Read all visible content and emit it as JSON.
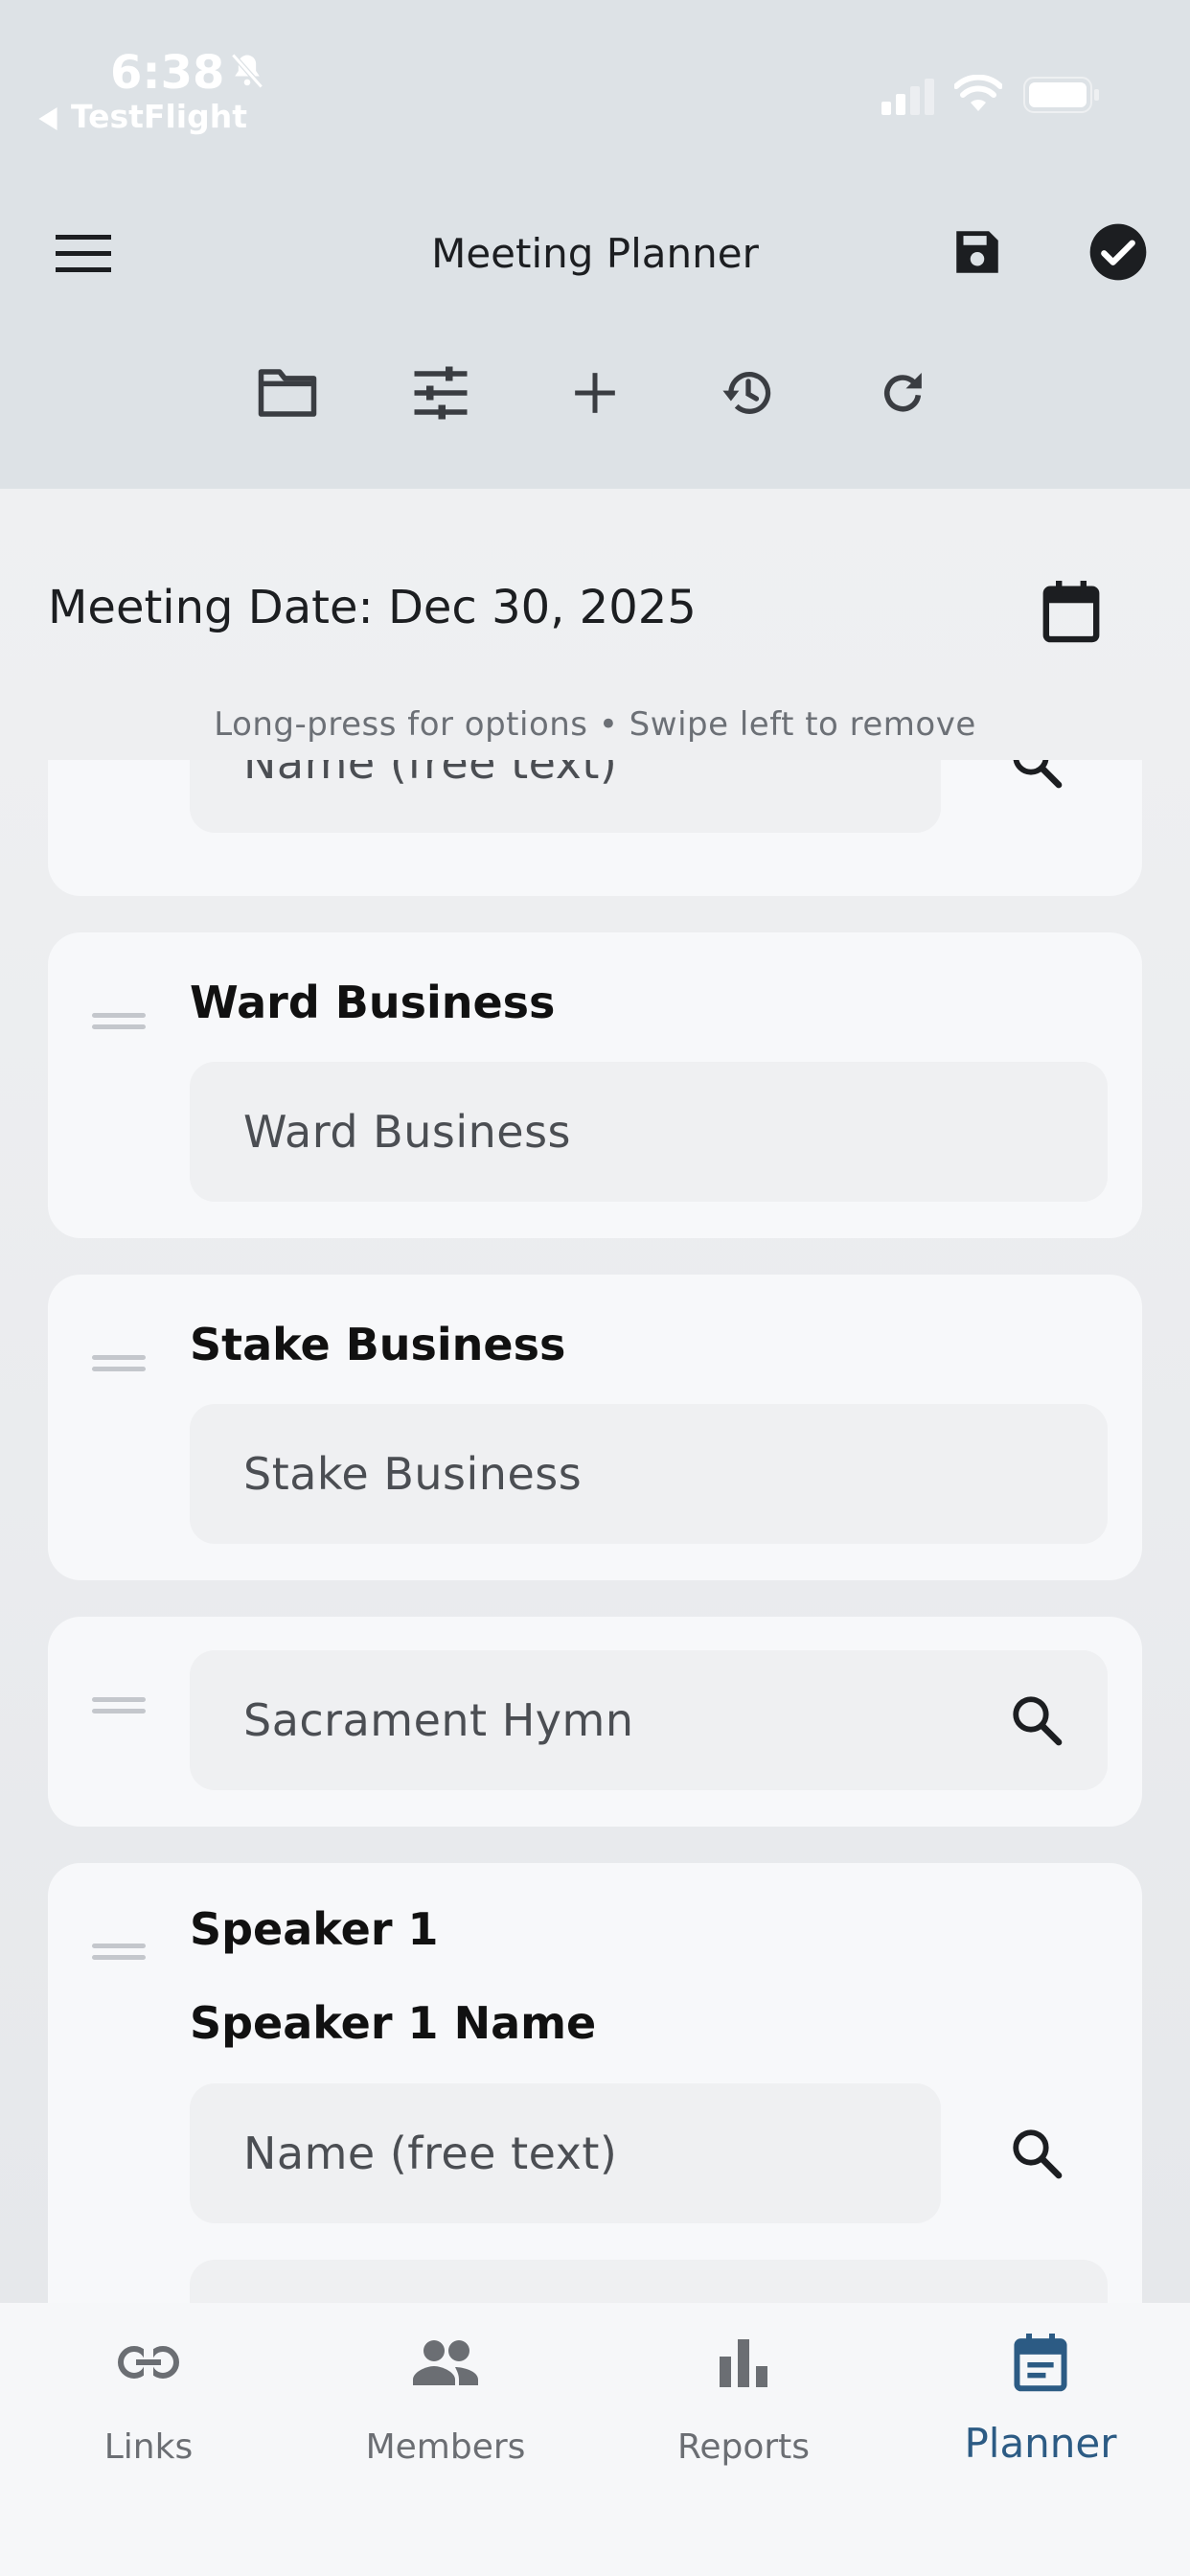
{
  "status_bar": {
    "time": "6:38",
    "back_app": "TestFlight"
  },
  "header": {
    "title": "Meeting Planner"
  },
  "meeting": {
    "date_text": "Meeting Date: Dec 30, 2025",
    "hint": "Long-press for options • Swipe left to remove"
  },
  "items": [
    {
      "placeholder": "Name (free text)"
    },
    {
      "label": "Ward Business",
      "placeholder": "Ward Business"
    },
    {
      "label": "Stake Business",
      "placeholder": "Stake Business"
    },
    {
      "placeholder": "Sacrament Hymn"
    },
    {
      "label": "Speaker 1",
      "sublabel": "Speaker 1 Name",
      "placeholder": "Name (free text)"
    }
  ],
  "tabs": [
    {
      "label": "Links",
      "icon": "link-icon"
    },
    {
      "label": "Members",
      "icon": "people-icon"
    },
    {
      "label": "Reports",
      "icon": "bar-chart-icon"
    },
    {
      "label": "Planner",
      "icon": "calendar-note-icon",
      "active": true
    }
  ],
  "colors": {
    "accent": "#2c5b84",
    "header_bg": "#dde2e6",
    "card_bg": "#f7f8fa",
    "field_bg": "#eff0f2"
  }
}
